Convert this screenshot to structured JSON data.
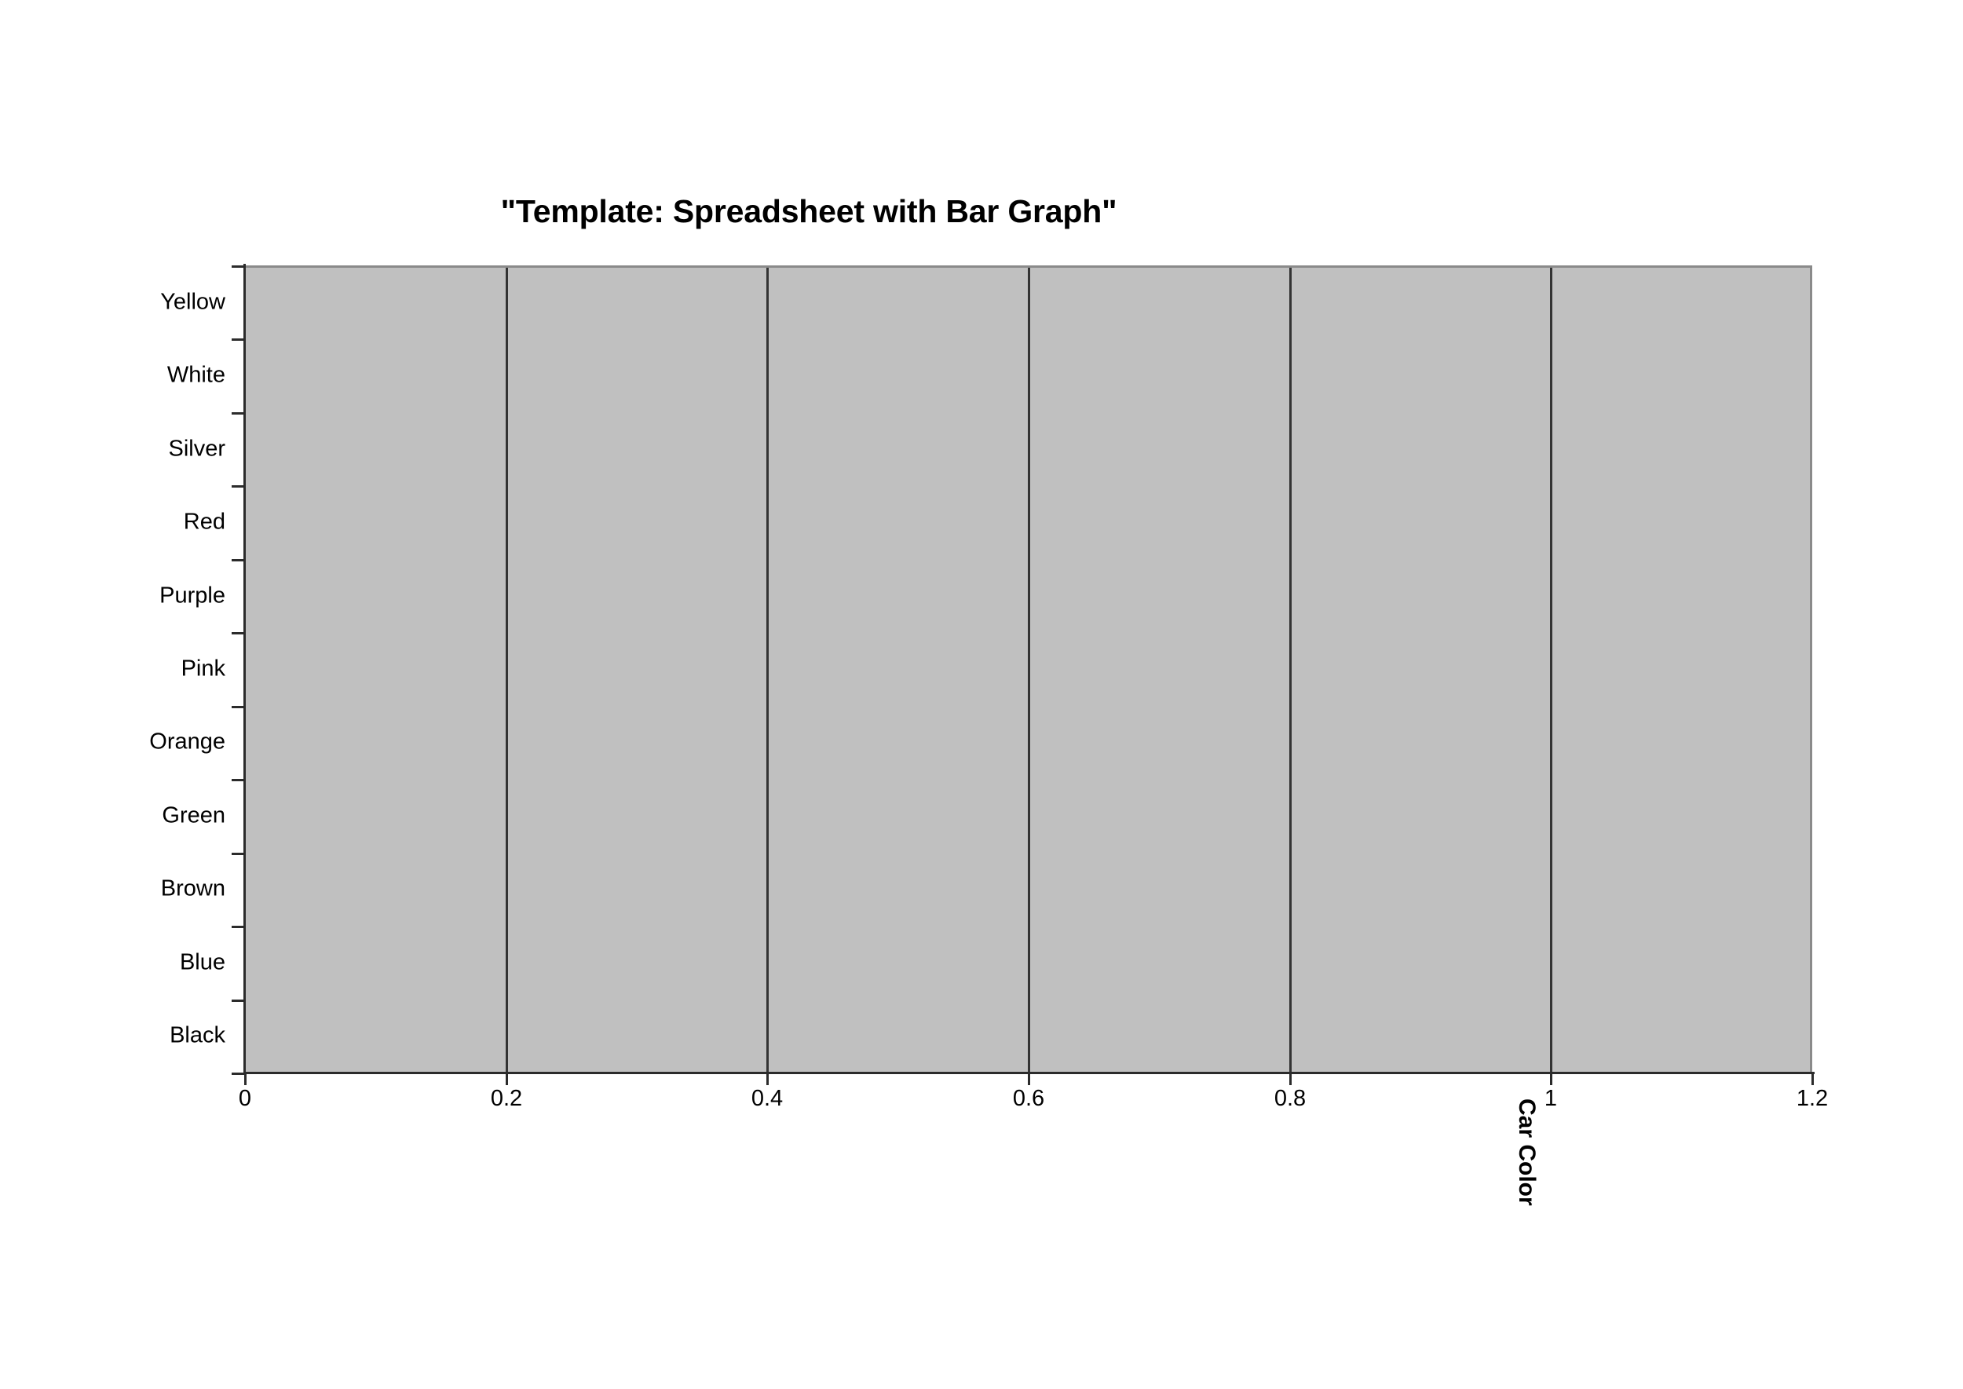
{
  "chart_data": {
    "type": "bar",
    "orientation": "horizontal",
    "title": "\"Template: Spreadsheet with Bar Graph\"",
    "xlabel": "Car Color",
    "ylabel": "",
    "categories": [
      "Yellow",
      "White",
      "Silver",
      "Red",
      "Purple",
      "Pink",
      "Orange",
      "Green",
      "Brown",
      "Blue",
      "Black"
    ],
    "values": [
      0,
      0,
      0,
      0,
      0,
      0,
      0,
      0,
      0,
      0,
      0
    ],
    "xlim": [
      0,
      1.2
    ],
    "xticks": [
      "0",
      "0.2",
      "0.4",
      "0.6",
      "0.8",
      "1",
      "1.2"
    ],
    "xtick_values": [
      0,
      0.2,
      0.4,
      0.6,
      0.8,
      1,
      1.2
    ],
    "gridlines_at": [
      0.2,
      0.4,
      0.6,
      0.8,
      1
    ],
    "grid": true,
    "legend": "none",
    "plot_background_color": "#c0c0c0",
    "gridline_color": "#333333",
    "axis_color": "#2b2b2b",
    "page_background_color": "#ffffff",
    "bars_rendered": false,
    "note": "Blank template: plot area is empty, no bars drawn"
  }
}
